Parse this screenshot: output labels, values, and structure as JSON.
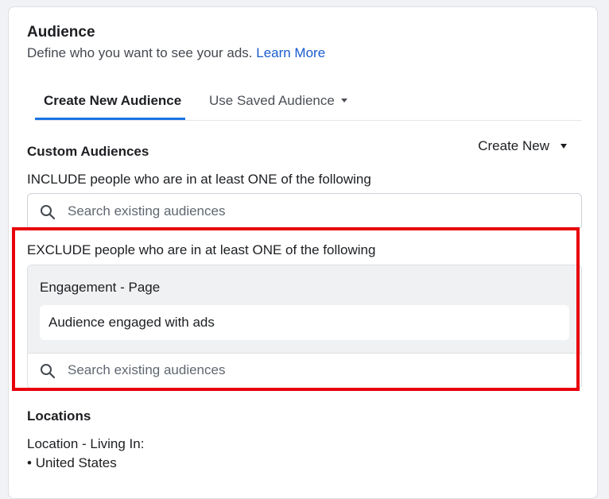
{
  "audience": {
    "title": "Audience",
    "subtitle": "Define who you want to see your ads.",
    "learn_more": "Learn More"
  },
  "tabs": [
    {
      "label": "Create New Audience",
      "active": true
    },
    {
      "label": "Use Saved Audience",
      "active": false
    }
  ],
  "custom_audiences": {
    "label": "Custom Audiences",
    "create_new": "Create New",
    "include_text": "INCLUDE people who are in at least ONE of the following",
    "include_search_placeholder": "Search existing audiences",
    "exclude_text": "EXCLUDE people who are in at least ONE of the following",
    "exclude_group_label": "Engagement - Page",
    "exclude_item": "Audience engaged with ads",
    "exclude_search_placeholder": "Search existing audiences"
  },
  "locations": {
    "label": "Locations",
    "location_type": "Location - Living In:",
    "items": [
      "United States"
    ]
  },
  "colors": {
    "accent": "#1b74e4",
    "link": "#1a5ccf",
    "highlight": "#e8000b"
  }
}
